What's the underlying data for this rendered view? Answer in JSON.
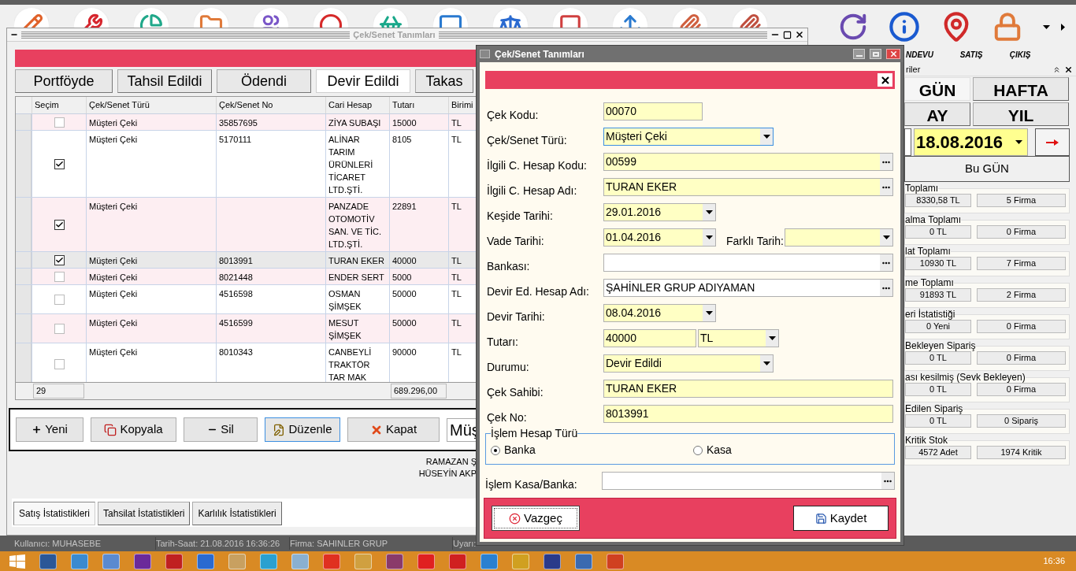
{
  "toolbar": {
    "labels": [
      "NDEVU",
      "SATIŞ",
      "ÇIKIŞ"
    ]
  },
  "left_window": {
    "title": "Çek/Senet Tanımları",
    "tabs": [
      {
        "label": "Portföyde",
        "selected": false
      },
      {
        "label": "Tahsil Edildi",
        "selected": false
      },
      {
        "label": "Ödendi",
        "selected": false
      },
      {
        "label": "Devir Edildi",
        "selected": true
      },
      {
        "label": "Takas",
        "selected": false
      }
    ],
    "table": {
      "columns": [
        "Seçim",
        "Çek/Senet Türü",
        "Çek/Senet No",
        "Cari Hesap",
        "Tutarı",
        "Birimi"
      ],
      "rows": [
        {
          "checked": false,
          "selected": false,
          "type": "Müşteri Çeki",
          "no": "35857695",
          "account": "ZİYA SUBAŞI",
          "amount": "15000",
          "currency": "TL"
        },
        {
          "checked": true,
          "selected": false,
          "type": "Müşteri Çeki",
          "no": "5170111",
          "account": "ALİNAR TARIM ÜRÜNLERİ TİCARET LTD.ŞTİ.",
          "amount": "8105",
          "currency": "TL"
        },
        {
          "checked": true,
          "selected": false,
          "type": "Müşteri Çeki",
          "account": "PANZADE OTOMOTİV SAN. VE TİC. LTD.ŞTİ.",
          "amount": "22891",
          "currency": "TL"
        },
        {
          "checked": true,
          "selected": true,
          "type": "Müşteri Çeki",
          "no": "8013991",
          "account": "TURAN EKER",
          "amount": "40000",
          "currency": "TL"
        },
        {
          "checked": false,
          "selected": false,
          "type": "Müşteri Çeki",
          "no": "8021448",
          "account": "ENDER SERT",
          "amount": "5000",
          "currency": "TL"
        },
        {
          "checked": false,
          "selected": false,
          "type": "Müşteri Çeki",
          "no": "4516598",
          "account": "OSMAN ŞİMŞEK",
          "amount": "50000",
          "currency": "TL"
        },
        {
          "checked": false,
          "selected": false,
          "type": "Müşteri Çeki",
          "no": "4516599",
          "account": "MESUT ŞİMŞEK",
          "amount": "50000",
          "currency": "TL"
        },
        {
          "checked": false,
          "selected": false,
          "type": "Müşteri Çeki",
          "no": "8010343",
          "account": "CANBEYLİ TRAKTÖR TAR MAK",
          "amount": "90000",
          "currency": "TL"
        }
      ],
      "footer": {
        "count": "29",
        "total": "689.296,00"
      }
    },
    "buttons": [
      {
        "label": "Yeni",
        "focused": false
      },
      {
        "label": "Kopyala",
        "focused": false
      },
      {
        "label": "Sil",
        "focused": false
      },
      {
        "label": "Düzenle",
        "focused": true
      },
      {
        "label": "Kapat",
        "focused": false
      }
    ],
    "search_value": "Müş",
    "names": [
      "RAMAZAN Ş",
      "HÜSEYİN AKP"
    ],
    "bottom_tabs": [
      {
        "label": "Satış İstatistikleri",
        "selected": true
      },
      {
        "label": "Tahsilat İstatistikleri",
        "selected": false
      },
      {
        "label": "Karlılık İstatistikleri",
        "selected": false
      }
    ]
  },
  "status_bar": [
    "Kullanıcı: MUHASEBE",
    "Tarih-Saat: 21.08.2016 16:36:26",
    "Firma: SAHINLER GRUP",
    "Uyarı:"
  ],
  "right_panel": {
    "title": "riler",
    "periods": [
      {
        "label": "GÜN",
        "selected": true
      },
      {
        "label": "HAFTA",
        "selected": false
      },
      {
        "label": "AY",
        "selected": false
      },
      {
        "label": "YIL",
        "selected": false
      }
    ],
    "date": "18.08.2016",
    "today_button": "Bu GÜN",
    "groups": [
      {
        "title": "Toplamı",
        "values": [
          "8330,58 TL",
          "5 Firma"
        ]
      },
      {
        "title": "alma Toplamı",
        "values": [
          "0 TL",
          "0 Firma"
        ]
      },
      {
        "title": "lat Toplamı",
        "values": [
          "10930 TL",
          "7 Firma"
        ]
      },
      {
        "title": "me Toplamı",
        "values": [
          "91893 TL",
          "2 Firma"
        ]
      },
      {
        "title": "eri İstatistiği",
        "values": [
          "0 Yeni",
          "0 Firma"
        ]
      },
      {
        "title": "Bekleyen Sipariş",
        "values": [
          "0 TL",
          "0 Firma"
        ]
      },
      {
        "title": "ası kesilmiş (Sevk Bekleyen)",
        "values": [
          "0 TL",
          "0 Firma"
        ]
      },
      {
        "title": "Edilen Sipariş",
        "values": [
          "0 TL",
          "0 Sipariş"
        ]
      },
      {
        "title": "Kritik Stok",
        "values": [
          "4572 Adet",
          "1974 Kritik"
        ]
      }
    ]
  },
  "dialog": {
    "title": "Çek/Senet Tanımları",
    "fields": [
      {
        "kind": "code",
        "label": "Çek Kodu:",
        "value": "00070",
        "highlighted": true,
        "focused": false
      },
      {
        "kind": "combo",
        "label": "Çek/Senet Türü:",
        "value": "Müşteri Çeki",
        "highlighted": true,
        "focused": true
      },
      {
        "kind": "lookup",
        "label": "İlgili C. Hesap Kodu:",
        "value": "00599",
        "highlighted": true,
        "focused": false
      },
      {
        "kind": "lookup",
        "label": "İlgili C. Hesap Adı:",
        "value": "TURAN EKER",
        "highlighted": true,
        "focused": false
      },
      {
        "kind": "date",
        "label": "Keşide Tarihi:",
        "value": "29.01.2016",
        "highlighted": true,
        "focused": false
      },
      {
        "kind": "date_pair",
        "label": "Vade Tarihi:",
        "value": "01.04.2016",
        "highlighted": true,
        "focused": false,
        "extra_label": "Farklı Tarih:"
      },
      {
        "kind": "lookup",
        "label": "Bankası:",
        "highlighted": false,
        "focused": false
      },
      {
        "kind": "lookup",
        "label": "Devir Ed. Hesap Adı:",
        "value": "ŞAHİNLER GRUP ADIYAMAN",
        "highlighted": false,
        "focused": false
      },
      {
        "kind": "date",
        "label": "Devir Tarihi:",
        "value": "08.04.2016",
        "highlighted": true,
        "focused": false
      },
      {
        "kind": "amount",
        "label": "Tutarı:",
        "value": "40000",
        "highlighted": true,
        "focused": false,
        "currency": "TL"
      },
      {
        "kind": "combo",
        "label": "Durumu:",
        "value": "Devir Edildi",
        "highlighted": true,
        "focused": false
      },
      {
        "kind": "text",
        "label": "Çek Sahibi:",
        "value": "TURAN EKER",
        "highlighted": true,
        "focused": false
      },
      {
        "kind": "text",
        "label": "Çek No:",
        "value": "8013991",
        "highlighted": true,
        "focused": false
      }
    ],
    "account_type": {
      "title": "İşlem Hesap Türü",
      "options": [
        {
          "label": "Banka",
          "selected": true
        },
        {
          "label": "Kasa",
          "selected": false
        }
      ]
    },
    "cash_bank": {
      "label": "İşlem Kasa/Banka:"
    },
    "buttons": [
      {
        "label": "Vazgeç",
        "kind": "cancel"
      },
      {
        "label": "Kaydet",
        "kind": "save"
      }
    ]
  },
  "taskbar": {
    "clock": "16:36"
  }
}
